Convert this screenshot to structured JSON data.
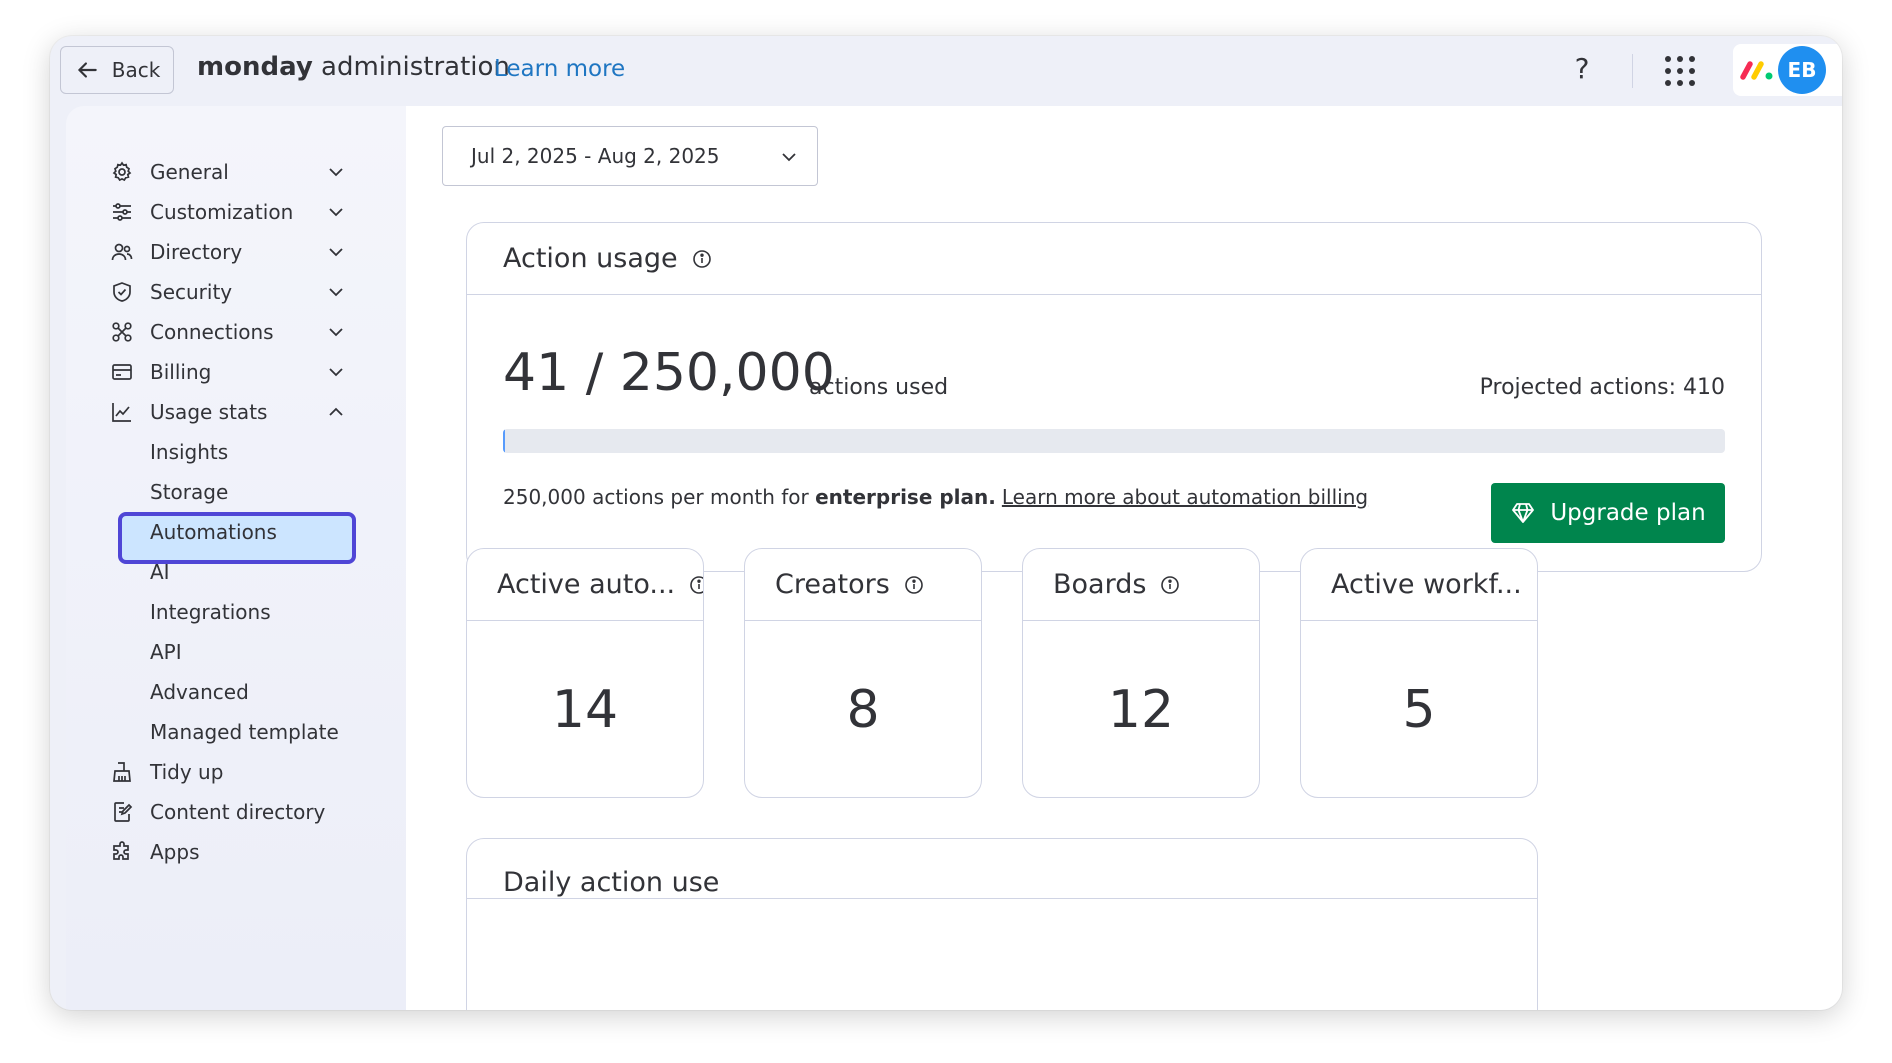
{
  "topbar": {
    "back_label": "Back",
    "title_bold": "monday",
    "title_rest": " administration",
    "learn_more": "Learn more",
    "help": "?",
    "avatar_initials": "EB"
  },
  "sidebar": {
    "items": [
      {
        "label": "General",
        "icon": "gear-icon",
        "expandable": true
      },
      {
        "label": "Customization",
        "icon": "sliders-icon",
        "expandable": true
      },
      {
        "label": "Directory",
        "icon": "people-icon",
        "expandable": true
      },
      {
        "label": "Security",
        "icon": "shield-icon",
        "expandable": true
      },
      {
        "label": "Connections",
        "icon": "connections-icon",
        "expandable": true
      },
      {
        "label": "Billing",
        "icon": "credit-card-icon",
        "expandable": true
      },
      {
        "label": "Usage stats",
        "icon": "chart-icon",
        "expandable": true,
        "expanded": true
      }
    ],
    "sub_items": [
      "Insights",
      "Storage",
      "Automations",
      "AI",
      "Integrations",
      "API",
      "Advanced",
      "Managed template"
    ],
    "selected_sub_item": "Automations",
    "bottom_items": [
      {
        "label": "Tidy up",
        "icon": "broom-icon"
      },
      {
        "label": "Content directory",
        "icon": "document-edit-icon"
      },
      {
        "label": "Apps",
        "icon": "puzzle-icon"
      }
    ]
  },
  "main": {
    "date_range": "Jul 2, 2025 - Aug 2, 2025",
    "action_usage": {
      "title": "Action usage",
      "used_display": "41 / 250,000",
      "used_suffix": "actions used",
      "projected": "Projected actions: 410",
      "progress_fraction": 0.000164,
      "plan_text_prefix": "250,000 actions per month for ",
      "plan_name": "enterprise plan.",
      "billing_link": "Learn more about automation billing",
      "upgrade_label": "Upgrade plan"
    },
    "stats": [
      {
        "title": "Active auto...",
        "value": "14"
      },
      {
        "title": "Creators",
        "value": "8"
      },
      {
        "title": "Boards",
        "value": "12"
      },
      {
        "title": "Active workf...",
        "value": "5"
      }
    ],
    "daily_title": "Daily action use"
  },
  "colors": {
    "accent_blue": "#1f76c2",
    "upgrade_green": "#00854d",
    "selected_border": "#4f46d6",
    "selected_bg": "#cce5ff",
    "avatar_bg": "#1f8ff0"
  }
}
